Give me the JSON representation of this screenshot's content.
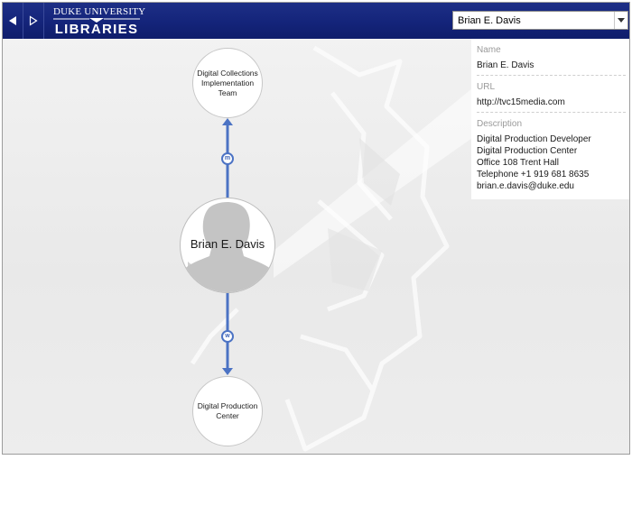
{
  "header": {
    "logo_top": "DUKE UNIVERSITY",
    "logo_bottom": "LIBRARIES",
    "brand_color": "#14247a"
  },
  "nav": {
    "back_icon": "triangle-left-icon",
    "forward_icon": "triangle-right-outline-icon"
  },
  "person_select": {
    "value": "Brian E. Davis"
  },
  "graph": {
    "top_node": "Digital Collections Implementation Team",
    "center_node": "Brian E. Davis",
    "bottom_node": "Digital Production Center",
    "upper_relation": "m",
    "lower_relation": "w",
    "edge_color": "#4c73c4"
  },
  "info": {
    "name_label": "Name",
    "name_value": "Brian E. Davis",
    "url_label": "URL",
    "url_value": "http://tvc15media.com",
    "description_label": "Description",
    "description_lines": [
      "Digital Production Developer",
      "Digital Production Center",
      "Office 108 Trent Hall",
      "Telephone +1 919 681 8635",
      "brian.e.davis@duke.edu"
    ]
  }
}
